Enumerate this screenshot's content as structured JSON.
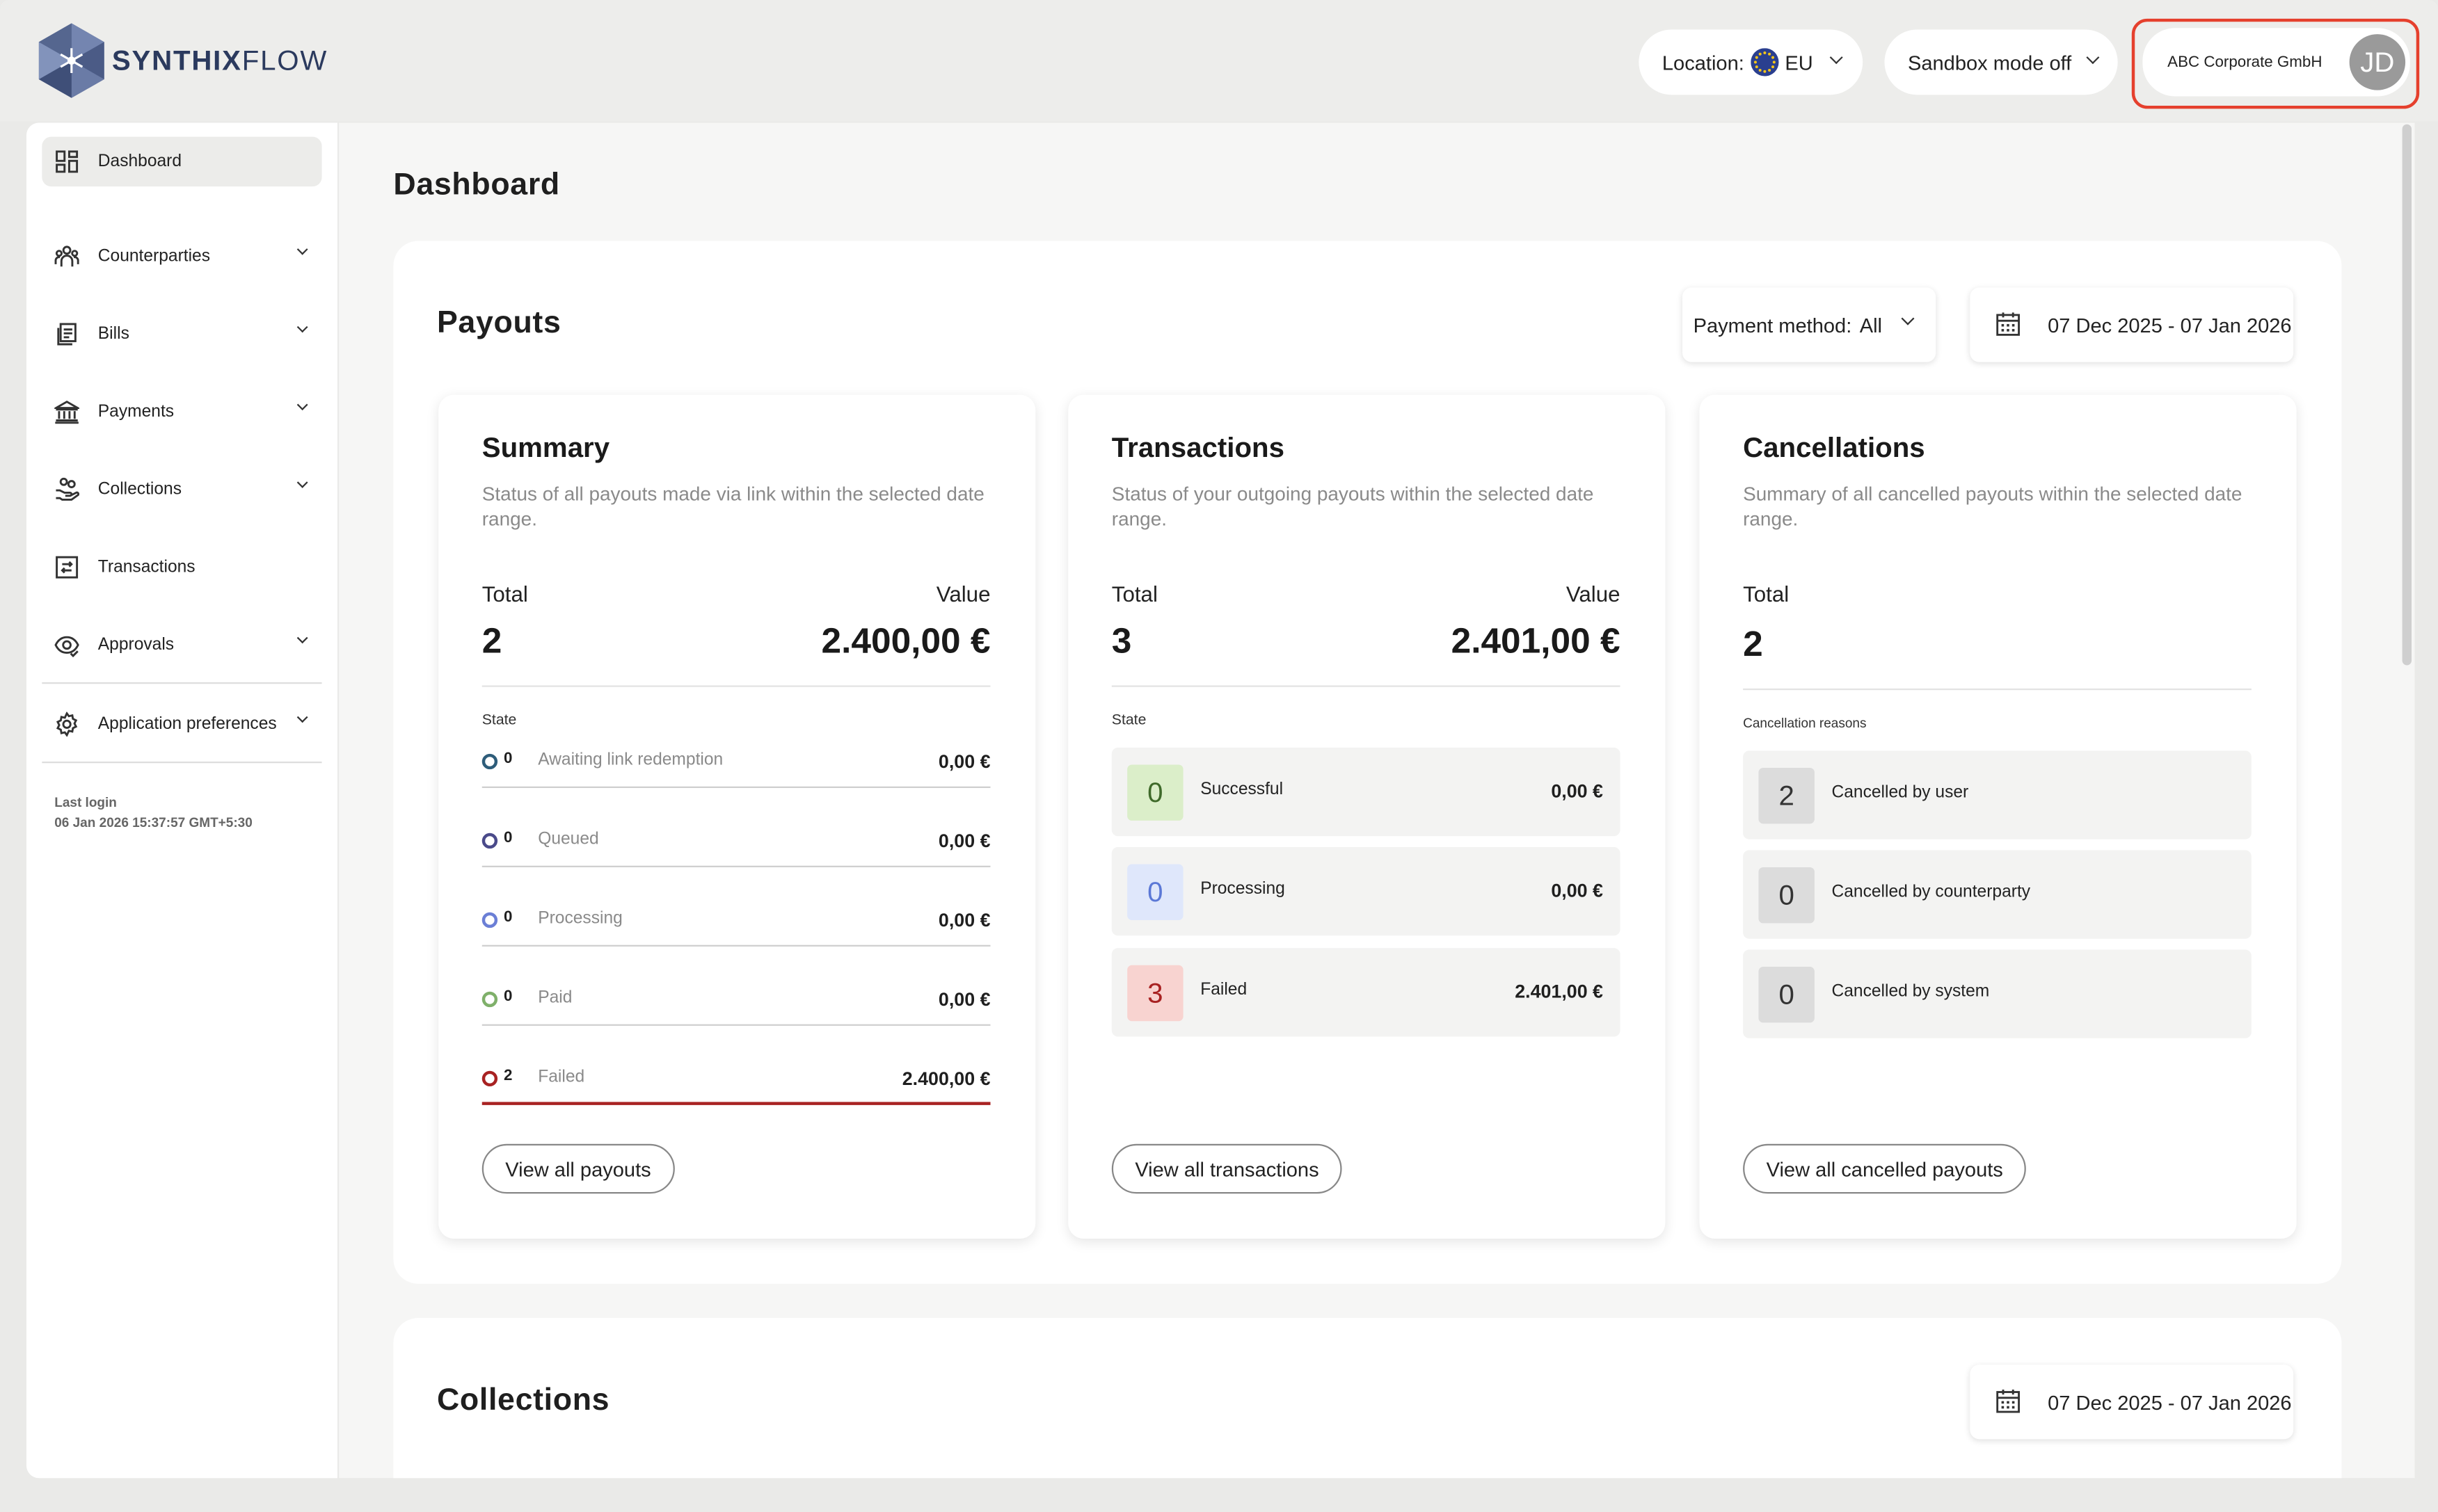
{
  "header": {
    "brand_bold": "SYNTHIX",
    "brand_light": "FLOW",
    "location_label": "Location:",
    "location_value": "EU",
    "sandbox_label": "Sandbox mode off",
    "org_name": "ABC Corporate GmbH",
    "avatar_initials": "JD",
    "highlight_color": "#e5402d"
  },
  "sidebar": {
    "items": [
      {
        "label": "Dashboard",
        "icon": "dashboard-icon",
        "active": true
      },
      {
        "label": "Counterparties",
        "icon": "people-icon"
      },
      {
        "label": "Bills",
        "icon": "bills-icon"
      },
      {
        "label": "Payments",
        "icon": "bank-icon"
      },
      {
        "label": "Collections",
        "icon": "hand-coins-icon"
      },
      {
        "label": "Transactions",
        "icon": "transfer-icon"
      },
      {
        "label": "Approvals",
        "icon": "eye-check-icon"
      },
      {
        "label": "Application preferences",
        "icon": "gear-icon"
      }
    ],
    "last_login_label": "Last login",
    "last_login_value": "06 Jan 2026 15:37:57 GMT+5:30"
  },
  "page": {
    "title": "Dashboard"
  },
  "payouts": {
    "title": "Payouts",
    "payment_method_label": "Payment method:",
    "payment_method_value": "All",
    "date_range": "07 Dec 2025 - 07 Jan 2026",
    "summary": {
      "title": "Summary",
      "description": "Status of all payouts made via link within the selected date range.",
      "total_label": "Total",
      "total": "2",
      "value_label": "Value",
      "value": "2.400,00 €",
      "state_label": "State",
      "states": [
        {
          "count": "0",
          "name": "Awaiting link redemption",
          "amount": "0,00 €",
          "color": "#2e5d7a"
        },
        {
          "count": "0",
          "name": "Queued",
          "amount": "0,00 €",
          "color": "#4a4a8a"
        },
        {
          "count": "0",
          "name": "Processing",
          "amount": "0,00 €",
          "color": "#6b7fd6"
        },
        {
          "count": "0",
          "name": "Paid",
          "amount": "0,00 €",
          "color": "#7fb06a"
        },
        {
          "count": "2",
          "name": "Failed",
          "amount": "2.400,00 €",
          "color": "#a82222"
        }
      ],
      "button": "View all payouts"
    },
    "transactions": {
      "title": "Transactions",
      "description": "Status of your outgoing payouts within the selected date range.",
      "total_label": "Total",
      "total": "3",
      "value_label": "Value",
      "value": "2.401,00 €",
      "state_label": "State",
      "rows": [
        {
          "count": "0",
          "name": "Successful",
          "amount": "0,00 €",
          "bg": "#dbeec9",
          "fg": "#3f6a2a"
        },
        {
          "count": "0",
          "name": "Processing",
          "amount": "0,00 €",
          "bg": "#dfe7fb",
          "fg": "#5b78d6"
        },
        {
          "count": "3",
          "name": "Failed",
          "amount": "2.401,00 €",
          "bg": "#f8d3d0",
          "fg": "#a82222"
        }
      ],
      "button": "View all transactions"
    },
    "cancellations": {
      "title": "Cancellations",
      "description": "Summary of all cancelled payouts within the selected date range.",
      "total_label": "Total",
      "total": "2",
      "reasons_label": "Cancellation reasons",
      "rows": [
        {
          "count": "2",
          "name": "Cancelled by user"
        },
        {
          "count": "0",
          "name": "Cancelled by counterparty"
        },
        {
          "count": "0",
          "name": "Cancelled by system"
        }
      ],
      "button": "View all cancelled payouts"
    }
  },
  "collections": {
    "title": "Collections",
    "date_range": "07 Dec 2025 - 07 Jan 2026"
  }
}
